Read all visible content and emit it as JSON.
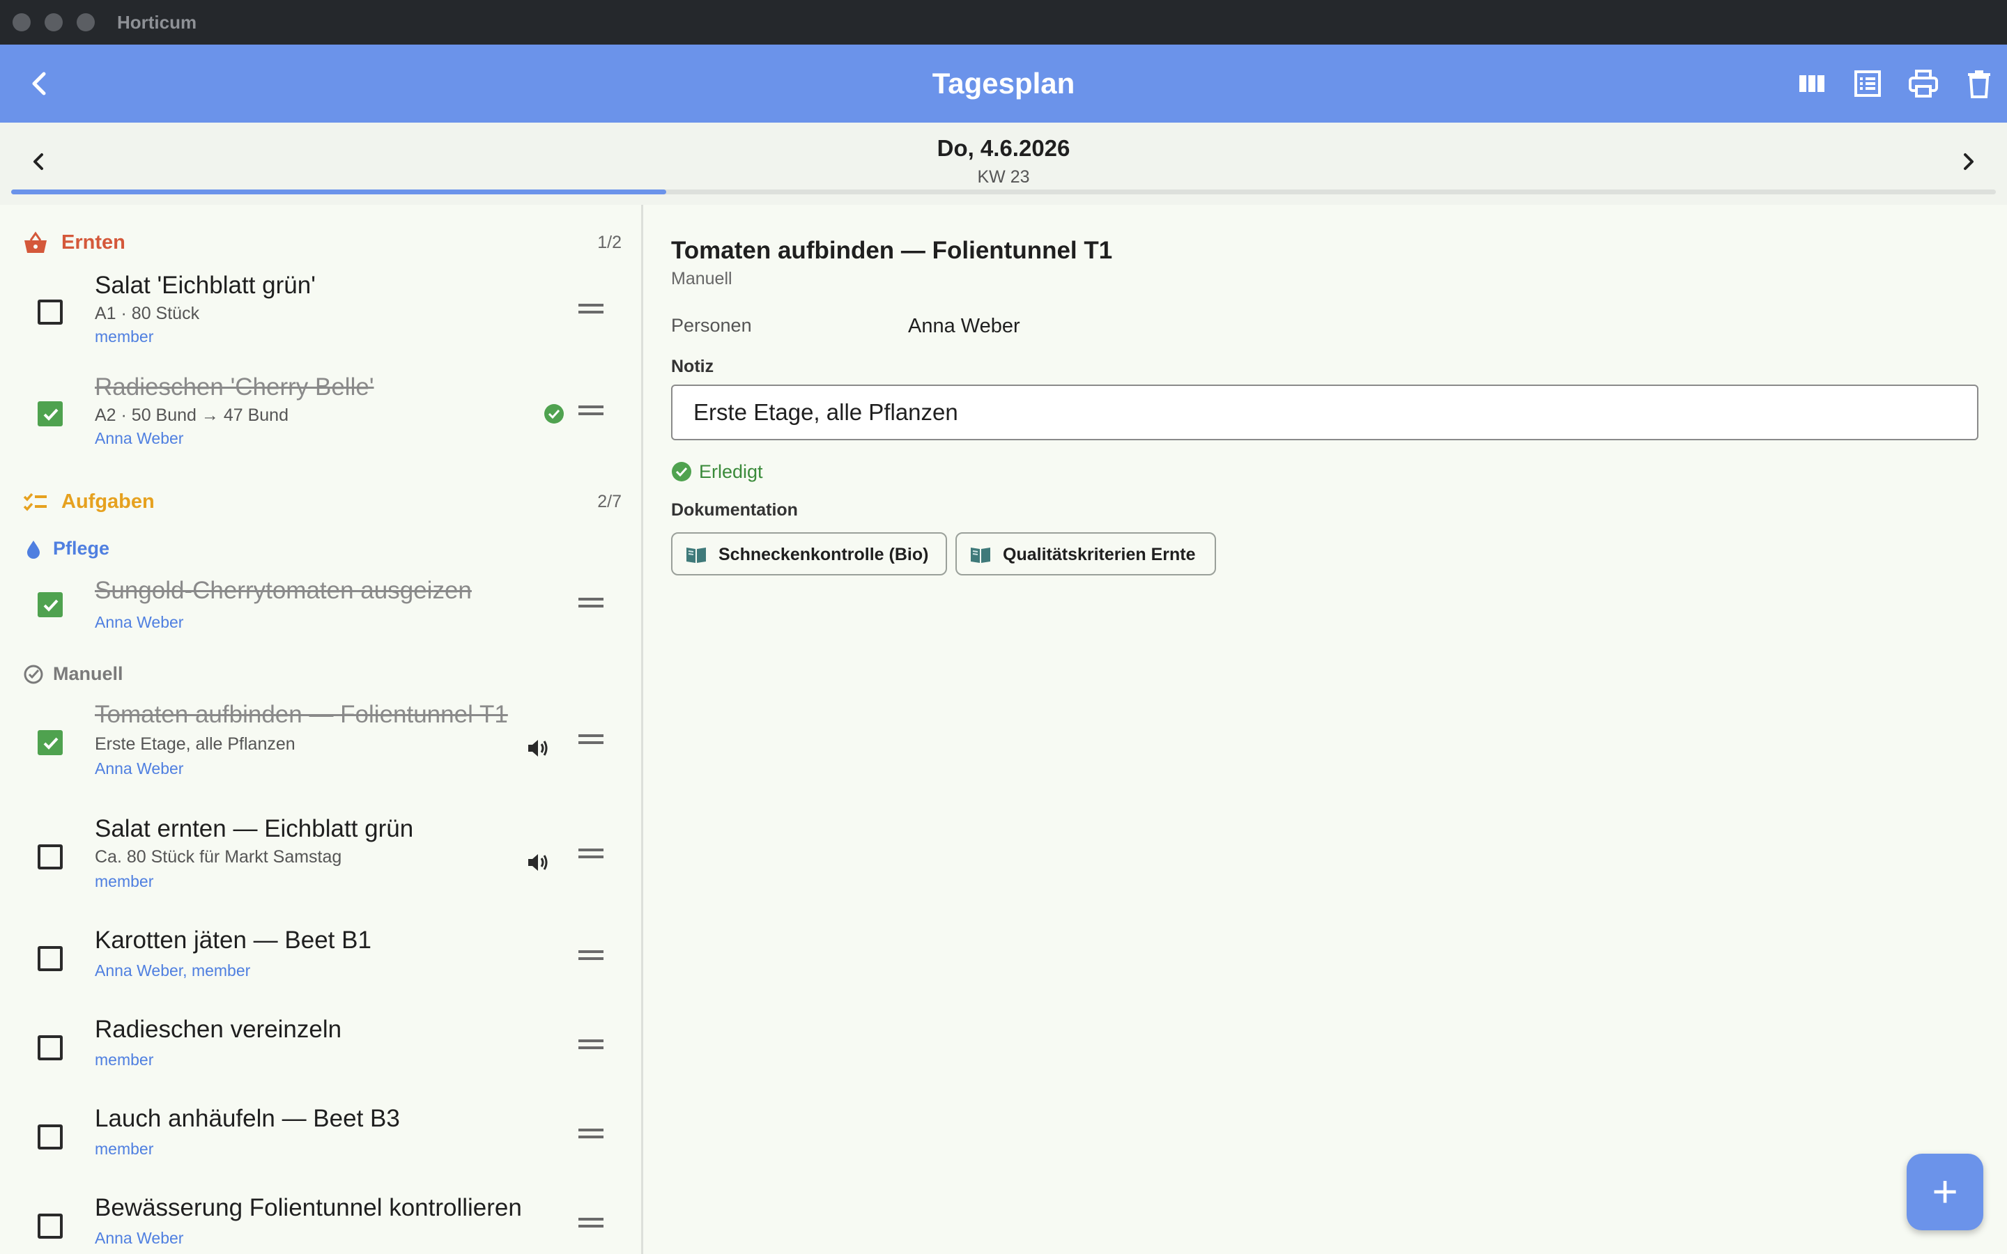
{
  "window": {
    "title": "Horticum"
  },
  "appbar": {
    "title": "Tagesplan",
    "icons": [
      "back-icon",
      "columns-view-icon",
      "list-view-icon",
      "print-icon",
      "delete-icon"
    ]
  },
  "date": {
    "main": "Do, 4.6.2026",
    "week": "KW 23",
    "progress": 0.33
  },
  "sections": {
    "ernten": {
      "label": "Ernten",
      "count": "1/2",
      "color": "#d4583a"
    },
    "aufgaben": {
      "label": "Aufgaben",
      "count": "2/7",
      "color": "#e6a11f"
    },
    "pflege": {
      "label": "Pflege",
      "color": "#4f7fe0"
    },
    "manuell": {
      "label": "Manuell",
      "color": "#7a7a7a"
    }
  },
  "tasks": [
    {
      "title": "Salat 'Eichblatt grün'",
      "meta": "A1 · 80 Stück",
      "person": "member",
      "done": false
    },
    {
      "title": "Radieschen 'Cherry Belle'",
      "meta": "A2 · 50 Bund → 47 Bund",
      "person": "Anna Weber",
      "done": true
    },
    {
      "title": "Sungold-Cherrytomaten ausgeizen",
      "person": "Anna Weber",
      "done": true
    },
    {
      "title": "Tomaten aufbinden — Folientunnel T1",
      "meta": "Erste Etage, alle Pflanzen",
      "person": "Anna Weber",
      "done": true
    },
    {
      "title": "Salat ernten — Eichblatt grün",
      "meta": "Ca. 80 Stück für Markt Samstag",
      "person": "member",
      "done": false
    },
    {
      "title": "Karotten jäten — Beet B1",
      "person": "Anna Weber, member",
      "done": false
    },
    {
      "title": "Radieschen vereinzeln",
      "person": "member",
      "done": false
    },
    {
      "title": "Lauch anhäufeln — Beet B3",
      "person": "member",
      "done": false
    },
    {
      "title": "Bewässerung Folientunnel kontrollieren",
      "person": "Anna Weber",
      "done": false
    }
  ],
  "detail": {
    "title": "Tomaten aufbinden — Folientunnel T1",
    "subtitle": "Manuell",
    "persons_label": "Personen",
    "persons_value": "Anna Weber",
    "note_label": "Notiz",
    "note_value": "Erste Etage, alle Pflanzen",
    "status": "Erledigt",
    "docs_label": "Dokumentation",
    "docs": [
      "Schneckenkontrolle (Bio)",
      "Qualitätskriterien Ernte"
    ]
  },
  "fab": {
    "label": "+"
  },
  "colors": {
    "accent": "#6b93ea",
    "done": "#4fa24f",
    "person": "#4f7fe0"
  }
}
